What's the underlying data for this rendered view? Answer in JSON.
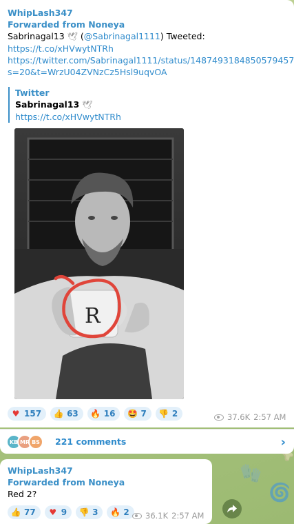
{
  "post1": {
    "sender": "WhipLash347",
    "forwarded": "Forwarded from Noneya",
    "author_name": "Sabrinagal13",
    "author_handle": "@Sabrinagal1111",
    "tweeted": "Tweeted:",
    "link1": "https://t.co/xHVwytNTRh",
    "link2_line1": "https://twitter.com/Sabrinagal1111/status/1487493184850579457?",
    "link2_line2": "s=20&t=WrzU04ZVNzCz5Hsl9uqvOA",
    "quote": {
      "title": "Twitter",
      "author": "Sabrinagal13",
      "link": "https://t.co/xHVwytNTRh"
    },
    "reactions": [
      {
        "emoji": "heart",
        "count": "157"
      },
      {
        "emoji": "thumbs-up",
        "count": "63"
      },
      {
        "emoji": "fire",
        "count": "16"
      },
      {
        "emoji": "star-struck",
        "count": "7"
      },
      {
        "emoji": "thumbs-down",
        "count": "2"
      }
    ],
    "views": "37.6K",
    "time": "2:57 AM",
    "comments": {
      "avatars": [
        "KB",
        "MR",
        "BS"
      ],
      "label": "221 comments"
    }
  },
  "post2": {
    "sender": "WhipLash347",
    "forwarded": "Forwarded from Noneya",
    "text": "Red 2?",
    "reactions": [
      {
        "emoji": "thumbs-up",
        "count": "77"
      },
      {
        "emoji": "heart",
        "count": "9"
      },
      {
        "emoji": "thumbs-down",
        "count": "3"
      },
      {
        "emoji": "fire",
        "count": "2"
      }
    ],
    "views": "36.1K",
    "time": "2:57 AM"
  },
  "colors": {
    "accent": "#3a8fc7",
    "reaction_bg": "#e3f0fa",
    "highlight_circle": "#e0453a"
  },
  "photo": {
    "mug_letter": "R"
  }
}
